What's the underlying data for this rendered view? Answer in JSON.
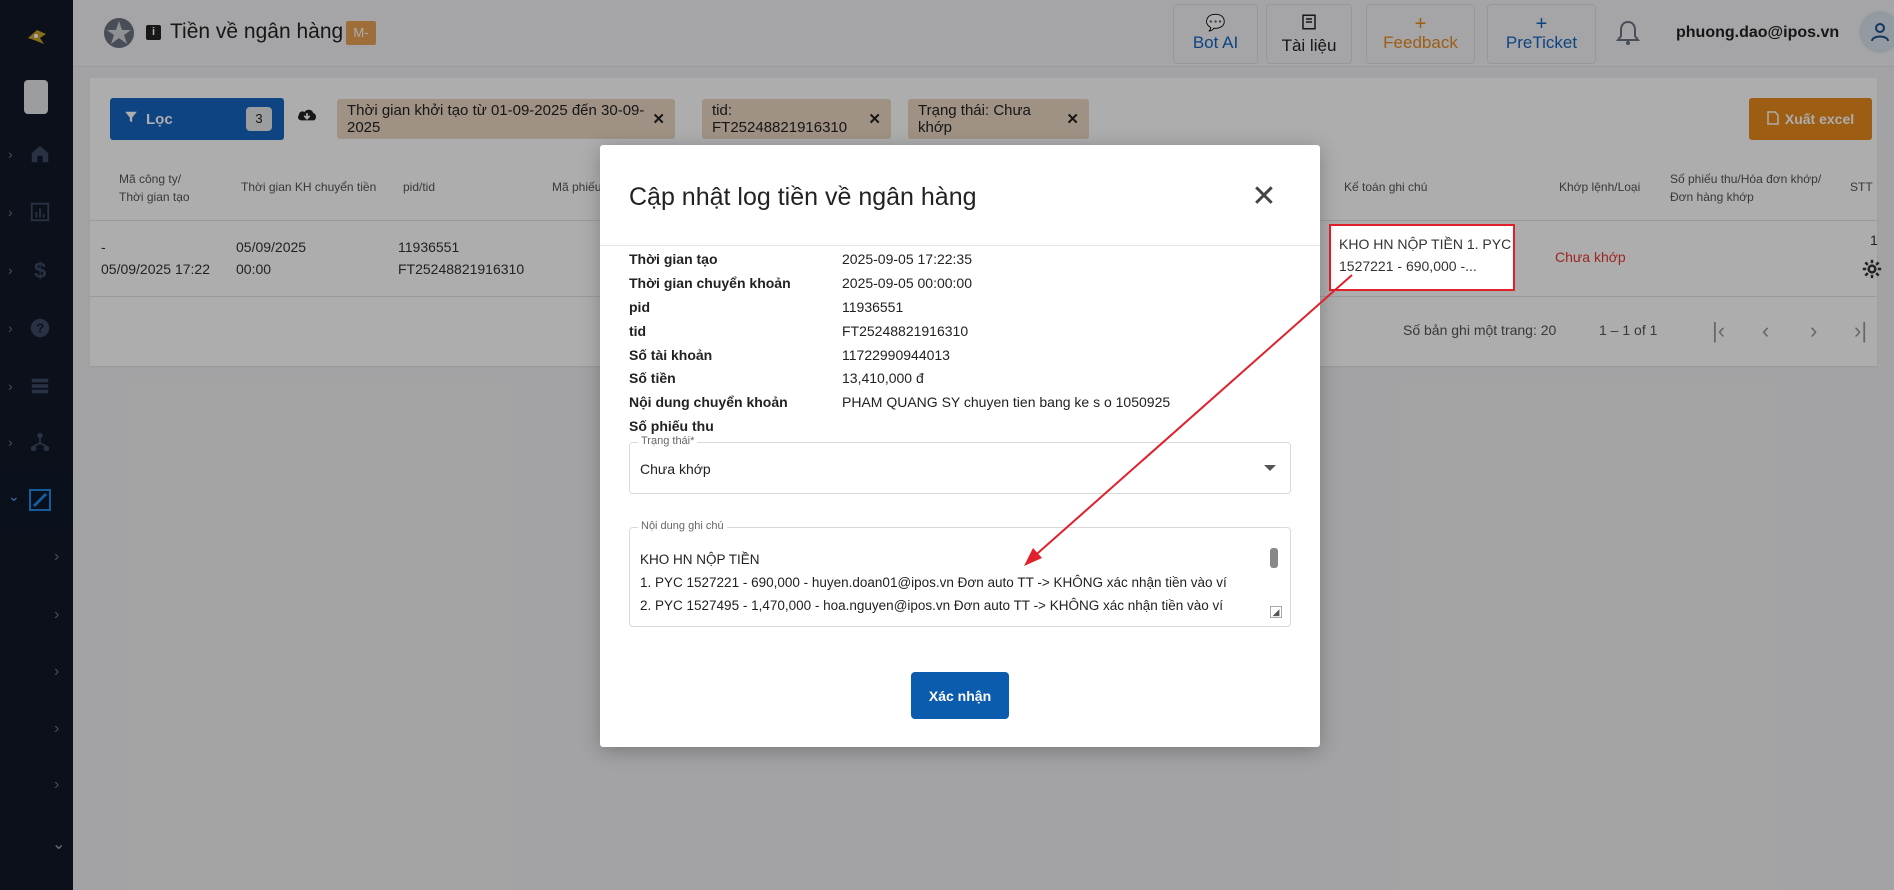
{
  "header": {
    "title": "Tiền về ngân hàng",
    "badge": "M-",
    "buttons": {
      "bot_ai": "Bot AI",
      "docs": "Tài liệu",
      "feedback": "Feedback",
      "preticket": "PreTicket"
    },
    "user_email": "phuong.dao@ipos.vn"
  },
  "toolbar": {
    "filter_label": "Lọc",
    "filter_count": "3",
    "chips": [
      "Thời gian khởi tạo từ 01-09-2025 đến 30-09-2025",
      "tid: FT25248821916310",
      "Trạng thái: Chưa khớp"
    ],
    "export_label": "Xuất excel"
  },
  "table": {
    "headers": {
      "company_created_1": "Mã công ty/",
      "company_created_2": "Thời gian tạo",
      "transfer_time": "Thời gian KH chuyển tiền",
      "pid_tid": "pid/tid",
      "receipt_code": "Mã phiếu",
      "accountant_note": "Kế toán ghi chú",
      "match_type": "Khớp lệnh/Loại",
      "receipt_no_1": "Số phiếu thu/Hóa đơn khớp/",
      "receipt_no_2": "Đơn hàng khớp",
      "stt": "STT"
    },
    "row": {
      "company": "-",
      "created": "05/09/2025 17:22",
      "transfer_date": "05/09/2025",
      "transfer_time": "00:00",
      "pid": "11936551",
      "tid": "FT25248821916310",
      "note_1": "KHO HN NỘP TIỀN 1. PYC",
      "note_2": "1527221 - 690,000 -...",
      "status": "Chưa khớp",
      "stt": "1"
    },
    "pagination": {
      "per_page": "Số bản ghi một trang: 20",
      "range": "1 – 1 of 1"
    }
  },
  "modal": {
    "title": "Cập nhật log tiền về ngân hàng",
    "fields": [
      {
        "label": "Thời gian tạo",
        "value": "2025-09-05 17:22:35"
      },
      {
        "label": "Thời gian chuyển khoản",
        "value": "2025-09-05 00:00:00"
      },
      {
        "label": "pid",
        "value": "11936551"
      },
      {
        "label": "tid",
        "value": "FT25248821916310"
      },
      {
        "label": "Số tài khoản",
        "value": "11722990944013"
      },
      {
        "label": "Số tiền",
        "value": "13,410,000 đ"
      },
      {
        "label": "Nội dung chuyển khoản",
        "value": "PHAM QUANG SY chuyen tien bang ke s o 1050925"
      },
      {
        "label": "Số phiếu thu",
        "value": ""
      }
    ],
    "status_label": "Trạng thái*",
    "status_value": "Chưa khớp",
    "note_label": "Nội dung ghi chú",
    "note_lines": [
      "KHO HN NỘP TIỀN",
      "1. PYC 1527221 - 690,000 - huyen.doan01@ipos.vn Đơn auto TT -> KHÔNG xác nhận tiền vào ví",
      "2. PYC 1527495 - 1,470,000 - hoa.nguyen@ipos.vn Đơn auto TT -> KHÔNG xác nhận tiền vào ví"
    ],
    "confirm_label": "Xác nhận"
  },
  "colors": {
    "primary": "#1565c0",
    "accent_orange": "#e8891c",
    "sidebar_bg": "#111827",
    "status_red": "#e53935",
    "highlight_red": "#e0212b"
  }
}
